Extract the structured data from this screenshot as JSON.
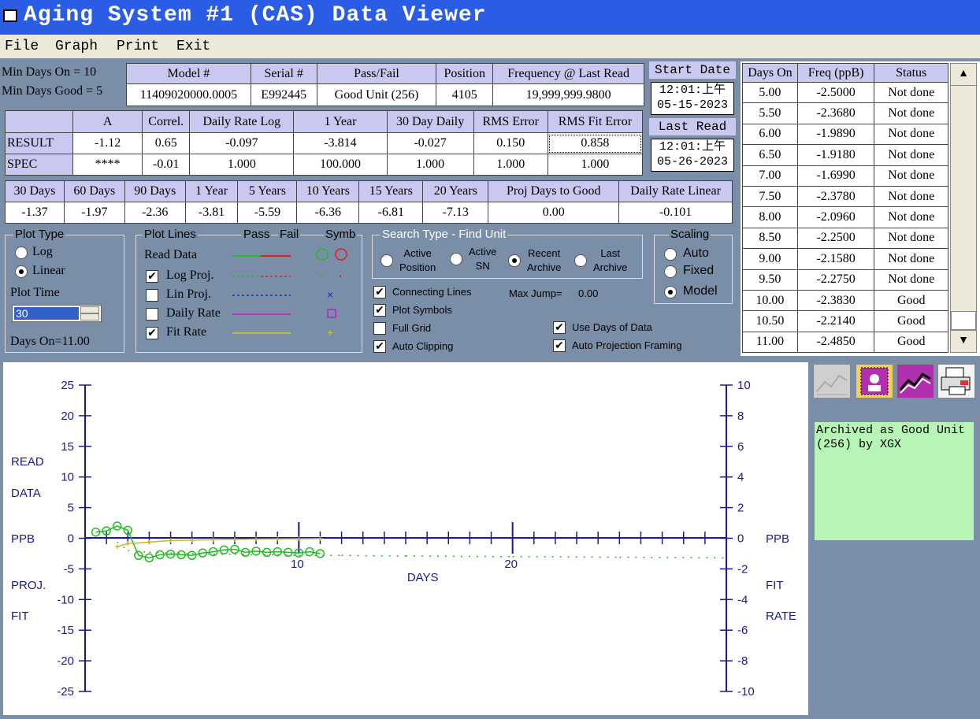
{
  "window": {
    "title": "Aging System #1 (CAS) Data Viewer"
  },
  "menu": [
    "File",
    "Graph",
    "Print",
    "Exit"
  ],
  "min_days": {
    "on": "Min Days On = 10",
    "good": "Min Days Good = 5"
  },
  "unit_table": {
    "headers": [
      "Model #",
      "Serial #",
      "Pass/Fail",
      "Position",
      "Frequency @ Last Read"
    ],
    "values": [
      "11409020000.0005",
      "E992445",
      "Good Unit (256)",
      "4105",
      "19,999,999.9800"
    ]
  },
  "dates": {
    "start_label": "Start Date",
    "start_time": "12:01:上午",
    "start_date": "05-15-2023",
    "last_label": "Last Read",
    "last_time": "12:01:上午",
    "last_date": "05-26-2023"
  },
  "result_table": {
    "headers": [
      "",
      "A",
      "Correl.",
      "Daily Rate Log",
      "1 Year",
      "30 Day Daily",
      "RMS Error",
      "RMS Fit Error"
    ],
    "rows": [
      [
        "RESULT",
        "-1.12",
        "0.65",
        "-0.097",
        "-3.814",
        "-0.027",
        "0.150",
        "0.858"
      ],
      [
        "SPEC",
        "****",
        "-0.01",
        "1.000",
        "100.000",
        "1.000",
        "1.000",
        "1.000"
      ]
    ]
  },
  "proj_table": {
    "headers": [
      "30 Days",
      "60 Days",
      "90 Days",
      "1 Year",
      "5 Years",
      "10 Years",
      "15 Years",
      "20 Years",
      "Proj Days to Good",
      "Daily Rate Linear"
    ],
    "values": [
      "-1.37",
      "-1.97",
      "-2.36",
      "-3.81",
      "-5.59",
      "-6.36",
      "-6.81",
      "-7.13",
      "0.00",
      "-0.101"
    ]
  },
  "plot_type": {
    "title": "Plot Type",
    "log": "Log",
    "linear": "Linear",
    "selected": "Linear",
    "plot_time_label": "Plot Time",
    "plot_time_value": "30",
    "days_on": "Days On=11.00"
  },
  "plot_lines": {
    "title": "Plot Lines",
    "pass": "Pass",
    "fail": "Fail",
    "symb": "Symb",
    "items": [
      {
        "label": "Read Data",
        "checkbox": false,
        "checked": false,
        "pass_color": "#22bb22",
        "fail_color": "#dd2222",
        "style": "solid"
      },
      {
        "label": "Log Proj.",
        "checkbox": true,
        "checked": true,
        "pass_color": "#22bb22",
        "fail_color": "#dd2222",
        "style": "dash"
      },
      {
        "label": "Lin Proj.",
        "checkbox": true,
        "checked": false,
        "pass_color": "#2222dd",
        "fail_color": "#2222dd",
        "style": "dash"
      },
      {
        "label": "Daily Rate",
        "checkbox": true,
        "checked": false,
        "pass_color": "#bb22bb",
        "fail_color": "#bb22bb",
        "style": "solid"
      },
      {
        "label": "Fit Rate",
        "checkbox": true,
        "checked": true,
        "pass_color": "#cccc22",
        "fail_color": "#cccc22",
        "style": "solid"
      }
    ]
  },
  "search_type": {
    "title": "Search Type - Find Unit",
    "options": [
      {
        "l1": "Active",
        "l2": "Position"
      },
      {
        "l1": "Active",
        "l2": "SN"
      },
      {
        "l1": "Recent",
        "l2": "Archive"
      },
      {
        "l1": "Last",
        "l2": "Archive"
      }
    ],
    "selected": 2
  },
  "options": {
    "connecting_lines": "Connecting Lines",
    "plot_symbols": "Plot Symbols",
    "full_grid": "Full Grid",
    "auto_clipping": "Auto Clipping",
    "max_jump_label": "Max Jump=",
    "max_jump_value": "0.00",
    "use_days": "Use Days of Data",
    "auto_proj": "Auto Projection Framing"
  },
  "scaling": {
    "title": "Scaling",
    "auto": "Auto",
    "fixed": "Fixed",
    "model": "Model",
    "selected": "Model"
  },
  "freq_list": {
    "headers": [
      "Days On",
      "Freq (ppB)",
      "Status"
    ],
    "rows": [
      [
        "5.00",
        "-2.5000",
        "Not done"
      ],
      [
        "5.50",
        "-2.3680",
        "Not done"
      ],
      [
        "6.00",
        "-1.9890",
        "Not done"
      ],
      [
        "6.50",
        "-1.9180",
        "Not done"
      ],
      [
        "7.00",
        "-1.6990",
        "Not done"
      ],
      [
        "7.50",
        "-2.3780",
        "Not done"
      ],
      [
        "8.00",
        "-2.0960",
        "Not done"
      ],
      [
        "8.50",
        "-2.2500",
        "Not done"
      ],
      [
        "9.00",
        "-2.1580",
        "Not done"
      ],
      [
        "9.50",
        "-2.2750",
        "Not done"
      ],
      [
        "10.00",
        "-2.3830",
        "Good"
      ],
      [
        "10.50",
        "-2.2140",
        "Good"
      ],
      [
        "11.00",
        "-2.4850",
        "Good"
      ]
    ]
  },
  "archived_note": "Archived as Good Unit (256) by XGX",
  "chart": {
    "left_labels": [
      "READ",
      "DATA",
      "PPB",
      "PROJ.",
      "FIT"
    ],
    "right_labels": [
      "PPB",
      "FIT",
      "RATE"
    ],
    "left_ticks": [
      "25",
      "20",
      "15",
      "10",
      "5",
      "0",
      "-5",
      "-10",
      "-15",
      "-20",
      "-25"
    ],
    "right_ticks": [
      "10",
      "8",
      "6",
      "4",
      "2",
      "0",
      "-2",
      "-4",
      "-6",
      "-8",
      "-10"
    ],
    "x_ticks": [
      "10",
      "20"
    ],
    "xlabel": "DAYS"
  },
  "chart_data": {
    "type": "line",
    "xlabel": "DAYS",
    "ylabel": "READ DATA PPB",
    "y2label": "PPB FIT RATE",
    "xlim": [
      0,
      30
    ],
    "ylim": [
      -25,
      25
    ],
    "y2lim": [
      -10,
      10
    ],
    "series": [
      {
        "name": "Read Data",
        "x": [
          0.5,
          1.0,
          1.5,
          2.0,
          2.5,
          3.0,
          3.5,
          4.0,
          4.5,
          5.0,
          5.5,
          6.0,
          6.5,
          7.0,
          7.5,
          8.0,
          8.5,
          9.0,
          9.5,
          10.0,
          10.5,
          11.0
        ],
        "y": [
          1.0,
          1.2,
          2.0,
          1.3,
          -2.8,
          -3.2,
          -2.7,
          -2.6,
          -2.7,
          -2.8,
          -2.4,
          -2.2,
          -1.9,
          -1.8,
          -2.3,
          -2.1,
          -2.3,
          -2.2,
          -2.3,
          -2.4,
          -2.2,
          -2.5
        ]
      },
      {
        "name": "Log Proj.",
        "x": [
          1.5,
          2,
          3,
          4,
          5,
          6,
          7,
          8,
          9,
          10,
          12,
          15,
          20,
          25,
          30
        ],
        "y": [
          -0.6,
          -2.0,
          -2.3,
          -2.4,
          -2.5,
          -2.6,
          -2.6,
          -2.7,
          -2.7,
          -2.8,
          -2.8,
          -2.9,
          -3.0,
          -3.1,
          -3.2
        ]
      },
      {
        "name": "Fit Rate",
        "x": [
          1.5,
          2,
          3,
          4,
          5,
          6,
          7,
          8,
          9,
          10,
          11
        ],
        "y": [
          -0.55,
          -0.35,
          -0.25,
          -0.15,
          -0.12,
          -0.1,
          -0.08,
          -0.05,
          -0.04,
          -0.03,
          -0.02
        ]
      }
    ]
  }
}
